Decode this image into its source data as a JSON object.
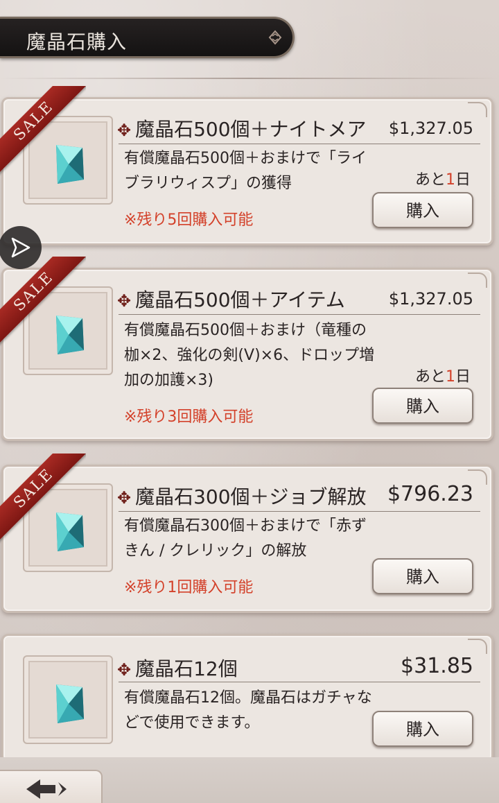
{
  "header": {
    "title": "魔晶石購入"
  },
  "buy_label": "購入",
  "sale_label": "SALE",
  "products": [
    {
      "title": "魔晶石500個＋ナイトメア",
      "price": "$1,327.05",
      "description": "有償魔晶石500個＋おまけで「ライブラリウィスプ」の獲得",
      "remaining": "※残り5回購入可能",
      "days_prefix": "あと",
      "days_num": "1",
      "days_suffix": "日",
      "sale": true
    },
    {
      "title": "魔晶石500個＋アイテム",
      "price": "$1,327.05",
      "description": "有償魔晶石500個＋おまけ（竜種の枷×2、強化の剣(V)×6、ドロップ増加の加護×3)",
      "remaining": "※残り3回購入可能",
      "days_prefix": "あと",
      "days_num": "1",
      "days_suffix": "日",
      "sale": true
    },
    {
      "title": "魔晶石300個＋ジョブ解放",
      "price": "$796.23",
      "description": "有償魔晶石300個＋おまけで「赤ずきん / クレリック」の解放",
      "remaining": "※残り1回購入可能",
      "sale": true
    },
    {
      "title": "魔晶石12個",
      "price": "$31.85",
      "description": "有償魔晶石12個。魔晶石はガチャなどで使用できます。",
      "sale": false
    }
  ],
  "icons": {
    "title_icon": "diamond-chevrons-icon",
    "title_mark": "cross-ornament-icon",
    "crystal": "magic-crystal-icon",
    "play": "play-icon",
    "back": "back-arrow-icon"
  },
  "colors": {
    "accent_red": "#d3412a",
    "ribbon": "#a82a23",
    "card_bg": "#ece6e1"
  }
}
